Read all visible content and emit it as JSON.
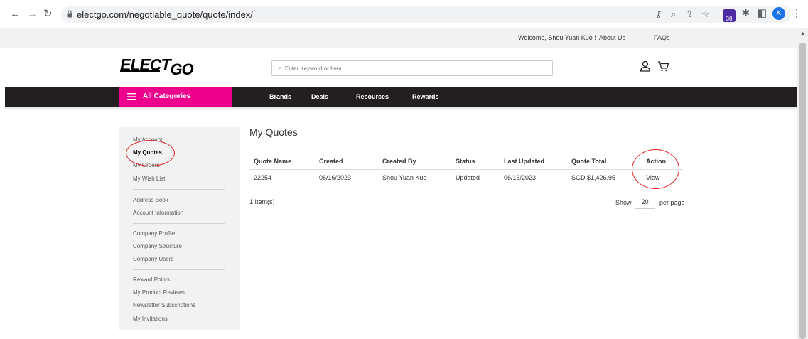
{
  "browser": {
    "url": "electgo.com/negotiable_quote/quote/index/",
    "extension_badge": "38",
    "profile_initial": "K"
  },
  "header": {
    "welcome": "Welcome, Shou Yuan Kuo !",
    "about": "About Us",
    "faqs": "FAQs",
    "logo_main": "ELECT",
    "logo_accent": "GO",
    "search_placeholder": "Enter Keyword or Item"
  },
  "nav": {
    "all_categories": "All Categories",
    "links": [
      "Brands",
      "Deals",
      "Resources",
      "Rewards"
    ]
  },
  "sidebar": {
    "group1": [
      "My Account",
      "My Quotes",
      "My Orders",
      "My Wish List"
    ],
    "group2": [
      "Address Book",
      "Account Information"
    ],
    "group3": [
      "Company Profile",
      "Company Structure",
      "Company Users"
    ],
    "group4": [
      "Reward Points",
      "My Product Reviews",
      "Newsletter Subscriptions",
      "My Invitations"
    ]
  },
  "main": {
    "title": "My Quotes",
    "columns": [
      "Quote Name",
      "Created",
      "Created By",
      "Status",
      "Last Updated",
      "Quote Total",
      "Action"
    ],
    "rows": [
      [
        "22254",
        "06/16/2023",
        "Shou Yuan Kuo",
        "Updated",
        "06/16/2023",
        "SGD $1,426.95",
        "View"
      ]
    ],
    "items_count": "1 Item(s)",
    "show_label": "Show",
    "per_page_value": "20",
    "per_page_label": "per page"
  },
  "colors": {
    "brand_pink": "#ec008c",
    "nav_dark": "#231f20",
    "annotation_red": "#e02020"
  }
}
